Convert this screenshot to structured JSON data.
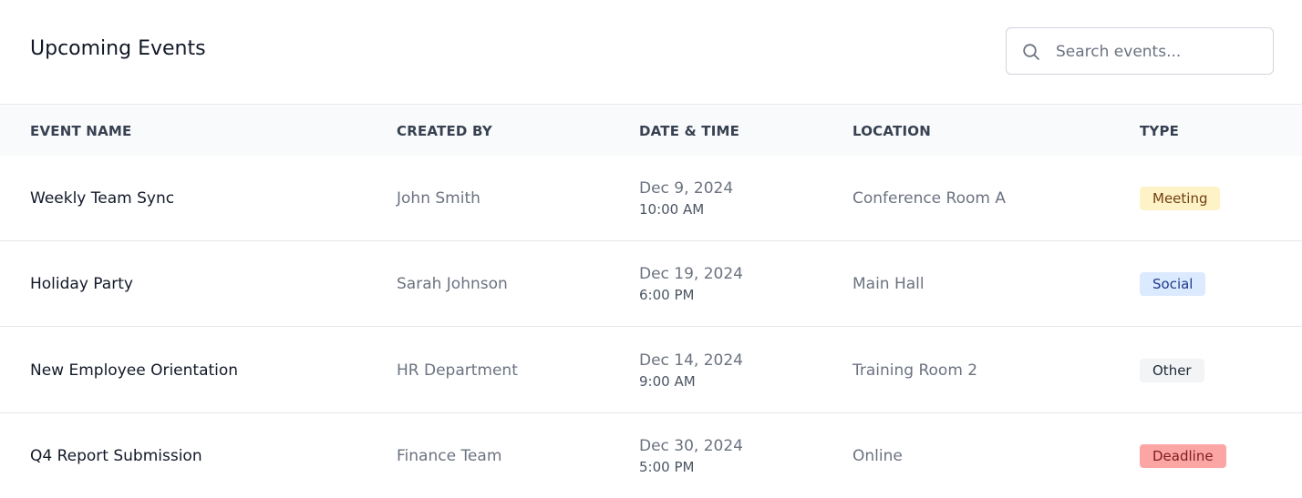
{
  "header": {
    "title": "Upcoming Events",
    "search": {
      "placeholder": "Search events...",
      "value": ""
    }
  },
  "table": {
    "columns": [
      "EVENT NAME",
      "CREATED BY",
      "DATE & TIME",
      "LOCATION",
      "TYPE"
    ],
    "rows": [
      {
        "name": "Weekly Team Sync",
        "created_by": "John Smith",
        "date": "Dec 9, 2024",
        "time": "10:00 AM",
        "location": "Conference Room A",
        "type": "Meeting"
      },
      {
        "name": "Holiday Party",
        "created_by": "Sarah Johnson",
        "date": "Dec 19, 2024",
        "time": "6:00 PM",
        "location": "Main Hall",
        "type": "Social"
      },
      {
        "name": "New Employee Orientation",
        "created_by": "HR Department",
        "date": "Dec 14, 2024",
        "time": "9:00 AM",
        "location": "Training Room 2",
        "type": "Other"
      },
      {
        "name": "Q4 Report Submission",
        "created_by": "Finance Team",
        "date": "Dec 30, 2024",
        "time": "5:00 PM",
        "location": "Online",
        "type": "Deadline"
      }
    ]
  },
  "colors": {
    "meeting_bg": "#fef3c7",
    "social_bg": "#dbeafe",
    "other_bg": "#f3f4f6",
    "deadline_bg": "#fca5a5"
  },
  "icons": {
    "search": "search-icon"
  }
}
